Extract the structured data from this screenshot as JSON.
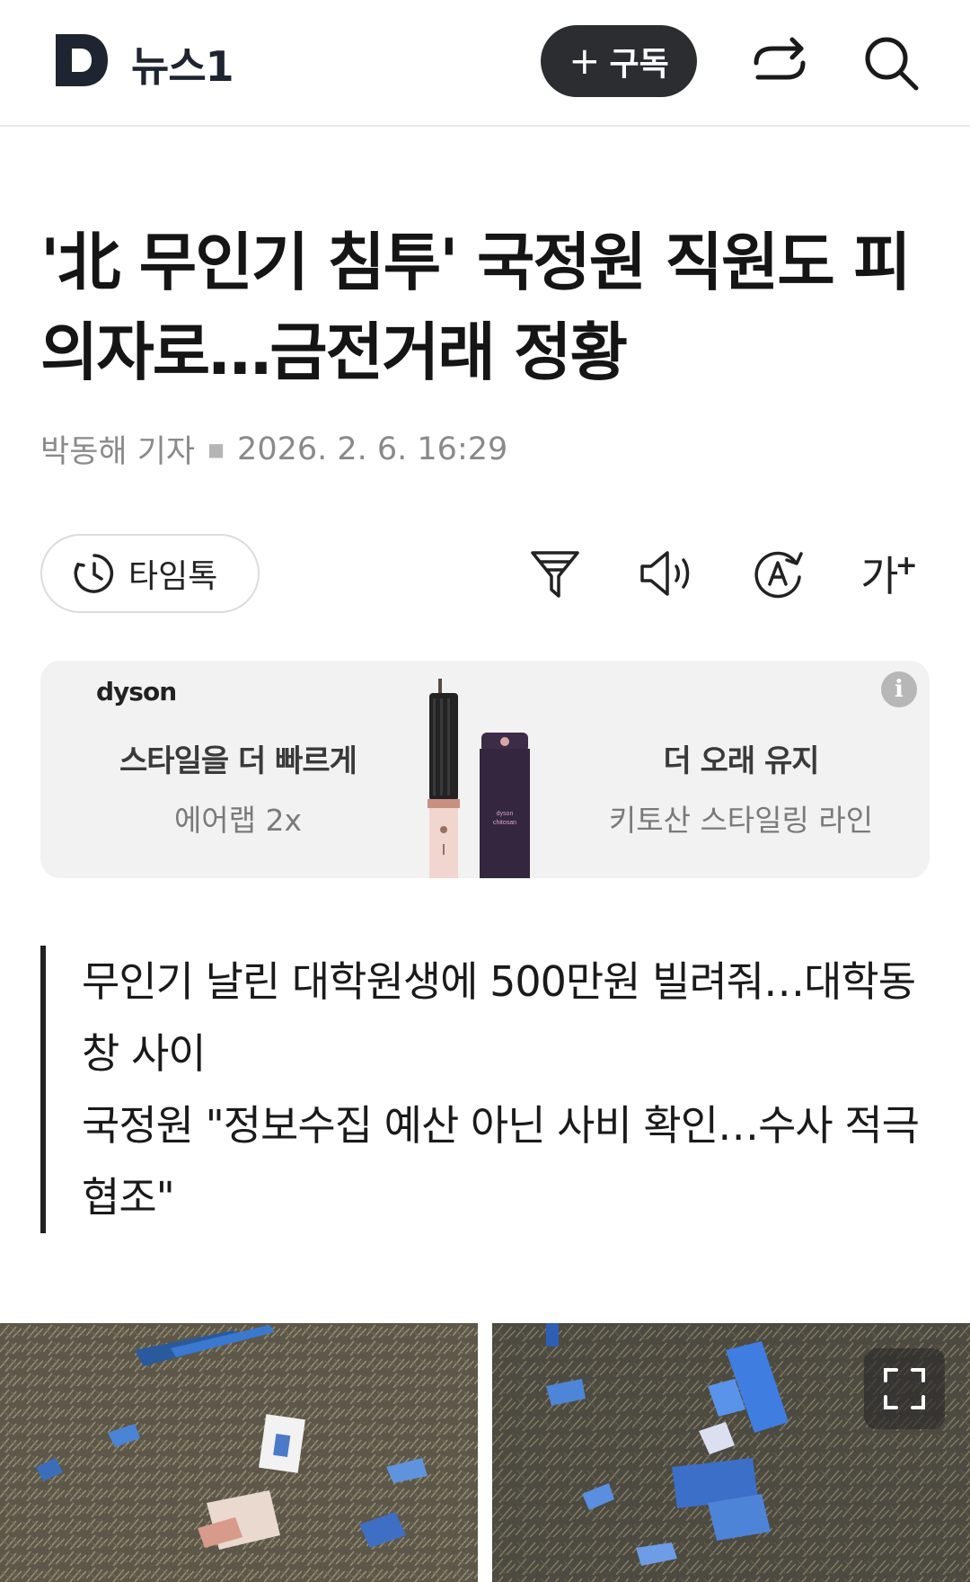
{
  "header": {
    "logo_text": "뉴스1",
    "subscribe_label": "구독",
    "icons": {
      "logo": "news1-d-logo-icon",
      "share": "share-icon",
      "search": "search-icon"
    }
  },
  "article": {
    "headline": "'北 무인기 침투' 국정원 직원도 피의자로…금전거래 정황",
    "reporter": "박동해 기자",
    "date": "2026. 2. 6. 16:29"
  },
  "toolbar": {
    "timetalk_label": "타임톡",
    "font_label": "가",
    "icons": [
      "clock-icon",
      "summary-icon",
      "audio-icon",
      "translate-icon",
      "font-size-icon"
    ]
  },
  "ad": {
    "brand": "dyson",
    "left_title": "스타일을 더 빠르게",
    "left_sub": "에어랩 2x",
    "right_title": "더 오래 유지",
    "right_sub": "키토산 스타일링 라인",
    "info_icon": "i"
  },
  "summary": [
    "무인기 날린 대학원생에 500만원 빌려줘…대학동창 사이",
    "국정원 \"정보수집 예산 아닌 사비 확인…수사 적극 협조\""
  ],
  "photo": {
    "expand_icon": "expand-icon"
  }
}
